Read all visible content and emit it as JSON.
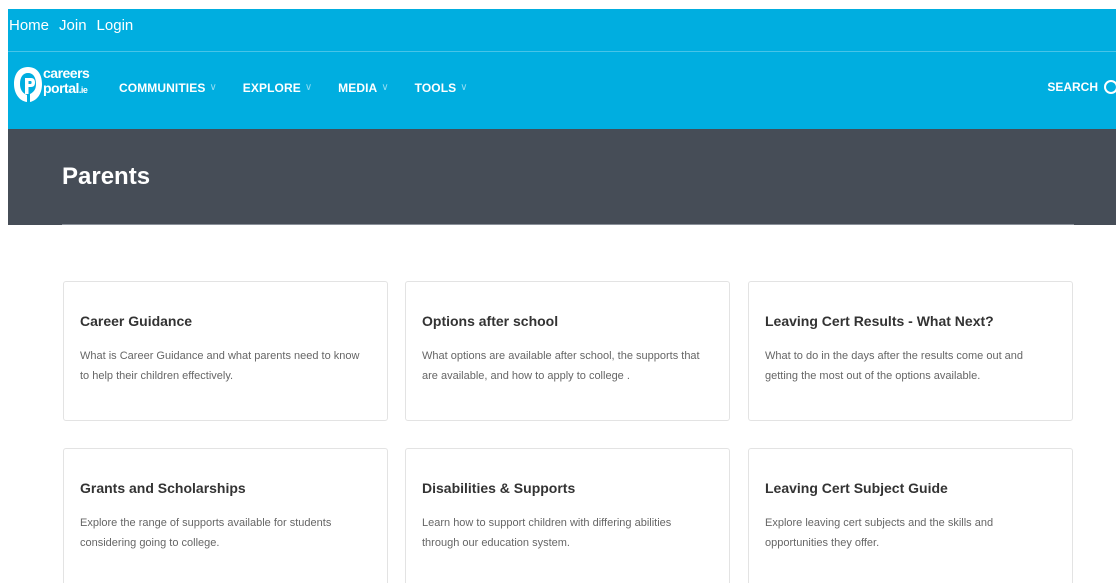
{
  "top_links": [
    "Home",
    "Join",
    "Login"
  ],
  "logo": {
    "line1": "careers",
    "line2": "portal",
    "suffix": ".ie"
  },
  "nav": {
    "items": [
      {
        "label": "COMMUNITIES"
      },
      {
        "label": "EXPLORE"
      },
      {
        "label": "MEDIA"
      },
      {
        "label": "TOOLS"
      }
    ],
    "chevron": "∨",
    "search_label": "SEARCH"
  },
  "page": {
    "title": "Parents"
  },
  "cards": [
    {
      "title": "Career Guidance",
      "description": "What is Career Guidance and what parents need to know to help their children effectively."
    },
    {
      "title": "Options after school",
      "description": "What options are available after school, the supports that are available, and how to apply to college ."
    },
    {
      "title": "Leaving Cert Results - What Next?",
      "description": "What to do in the days after the results come out and getting the most out of the options available."
    },
    {
      "title": "Grants and Scholarships",
      "description": "Explore the range of supports available for students considering going to college."
    },
    {
      "title": "Disabilities & Supports",
      "description": "Learn how to support children with differing abilities through our education system."
    },
    {
      "title": "Leaving Cert Subject Guide",
      "description": "Explore leaving cert subjects and the skills and opportunities they offer."
    }
  ],
  "colors": {
    "header_bg": "#00aee0",
    "hero_bg": "#464d57",
    "chevron": "#8fdcf3"
  }
}
